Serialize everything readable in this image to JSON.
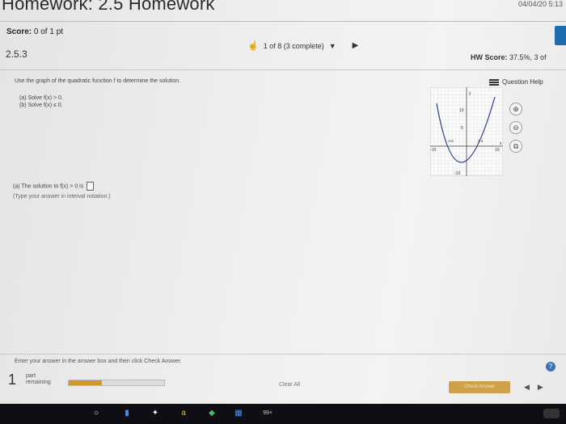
{
  "page": {
    "title": "Homework: 2.5 Homework",
    "datetime": "04/04/20 5:13"
  },
  "score": {
    "label": "Score:",
    "value": "0 of 1 pt"
  },
  "question": {
    "number": "2.5.3"
  },
  "nav": {
    "counter": "1 of 8 (3 complete)",
    "dropdown_icon": "caret-down-icon",
    "next_icon": "play-icon"
  },
  "hw_score": {
    "label": "HW Score:",
    "value": "37.5%, 3 of"
  },
  "help": {
    "label": "Question Help"
  },
  "problem": {
    "prompt": "Use the graph of the quadratic function f to determine the solution.",
    "part_a": "(a) Solve f(x) > 0.",
    "part_b": "(b) Solve f(x) ≤ 0."
  },
  "graph": {
    "y_top_label": "10",
    "y_mid_label": "5",
    "y_bottom_label": "-10",
    "x_left_label": "-10",
    "x_right_label": "10",
    "x_neg_root_label": "-4.6",
    "x_pos_root_label": "3.4",
    "axis_y": "y",
    "axis_x": "x"
  },
  "tools": [
    {
      "icon": "zoom-in-icon",
      "glyph": "⊕"
    },
    {
      "icon": "zoom-out-icon",
      "glyph": "⊖"
    },
    {
      "icon": "external-link-icon",
      "glyph": "⧉"
    }
  ],
  "answer": {
    "prompt": "(a) The solution to f(x) > 0 is",
    "hint": "(Type your answer in interval notation.)"
  },
  "instruction": "Enter your answer in the answer box and then click Check Answer.",
  "footer": {
    "part_number": "1",
    "part_label_1": "part",
    "part_label_2": "remaining",
    "progress_pct": 35,
    "clear_all": "Clear All",
    "check_answer": "Check Answer"
  },
  "taskbar": {
    "badge": "99+"
  }
}
